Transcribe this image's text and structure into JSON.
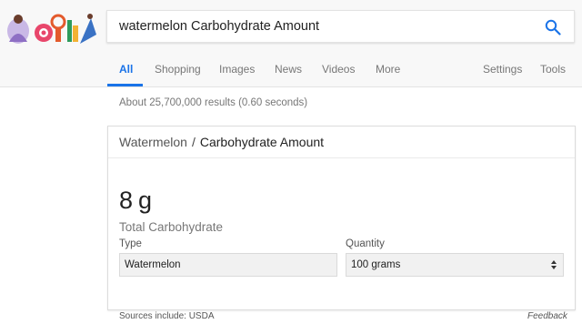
{
  "search": {
    "query": "watermelon Carbohydrate Amount"
  },
  "tabs": [
    {
      "label": "All",
      "active": true
    },
    {
      "label": "Shopping"
    },
    {
      "label": "Images"
    },
    {
      "label": "News"
    },
    {
      "label": "Videos"
    },
    {
      "label": "More"
    }
  ],
  "tools": {
    "settings": "Settings",
    "tools": "Tools"
  },
  "result_stats": "About 25,700,000 results (0.60 seconds)",
  "card": {
    "breadcrumb": {
      "parent": "Watermelon",
      "separator": "/",
      "current": "Carbohydrate Amount"
    },
    "value": "8",
    "unit": "g",
    "nutrient_label": "Total Carbohydrate",
    "type_label": "Type",
    "type_value": "Watermelon",
    "quantity_label": "Quantity",
    "quantity_value": "100 grams"
  },
  "footer": {
    "sources": "Sources include: USDA",
    "feedback": "Feedback"
  },
  "colors": {
    "accent": "#1a73e8",
    "header_bg": "#f8f8f8"
  },
  "icons": {
    "search": "search-icon",
    "select_arrows": "up-down-arrows-icon"
  }
}
